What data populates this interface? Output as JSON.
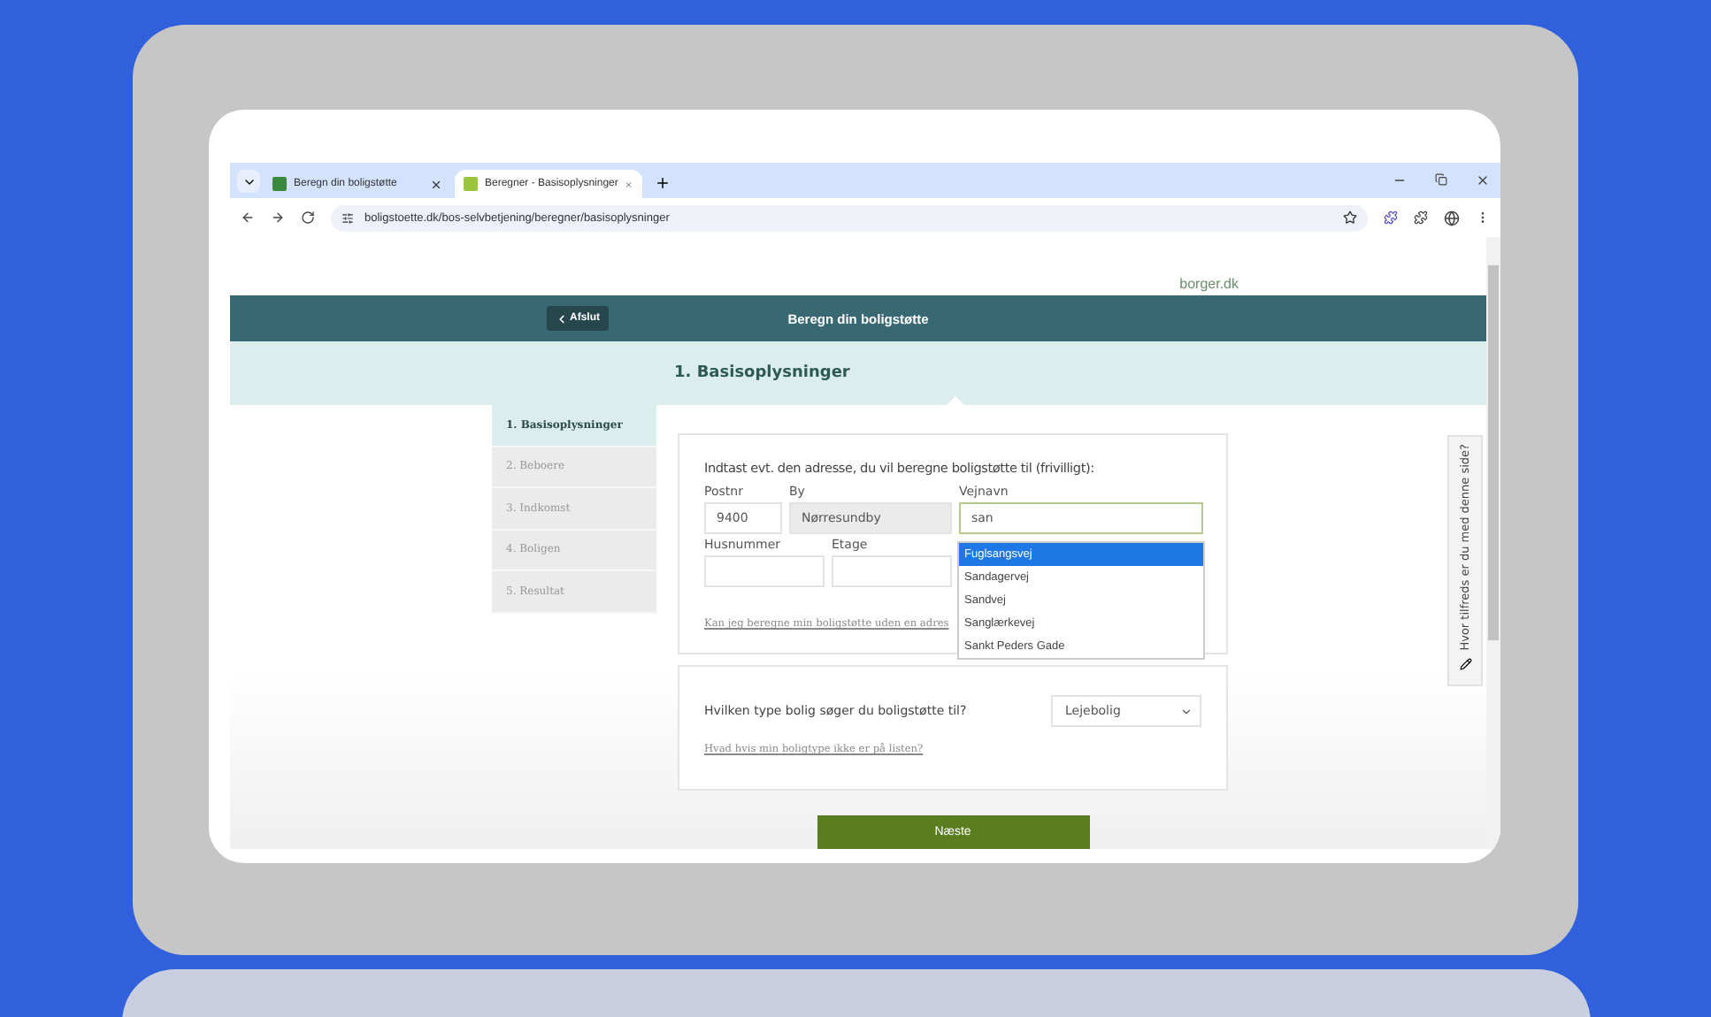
{
  "browser": {
    "tabs": [
      {
        "title": "Beregn din boligstøtte",
        "selected": false
      },
      {
        "title": "Beregner - Basisoplysninger",
        "selected": true
      }
    ],
    "url": "boligstoette.dk/bos-selvbetjening/beregner/basisoplysninger"
  },
  "brand": "borger.dk",
  "header": {
    "back_button": "Afslut",
    "title": "Beregn din boligstøtte"
  },
  "step_title": "1. Basisoplysninger",
  "steps": [
    {
      "label": "1. Basisoplysninger",
      "selected": true
    },
    {
      "label": "2. Beboere",
      "selected": false
    },
    {
      "label": "3. Indkomst",
      "selected": false
    },
    {
      "label": "4. Boligen",
      "selected": false
    },
    {
      "label": "5. Resultat",
      "selected": false
    }
  ],
  "address": {
    "prompt": "Indtast evt. den adresse, du vil beregne boligstøtte til (frivilligt):",
    "row_1": [
      {
        "label": "Postnr",
        "value": "9400",
        "disabled": false,
        "focused": false
      },
      {
        "label": "By",
        "value": "Nørresundby",
        "disabled": true,
        "focused": false
      },
      {
        "label": "Vejnavn",
        "value": "san",
        "disabled": false,
        "focused": true
      }
    ],
    "row_2": [
      {
        "label": "Husnummer",
        "disabled": false,
        "focused": false
      },
      {
        "label": "Etage",
        "disabled": false,
        "focused": false
      }
    ],
    "suggestions": [
      {
        "label": "Fuglsangsvej",
        "selected": true
      },
      {
        "label": "Sandagervej",
        "selected": false
      },
      {
        "label": "Sandvej",
        "selected": false
      },
      {
        "label": "Sanglærkevej",
        "selected": false
      },
      {
        "label": "Sankt Peders Gade",
        "selected": false
      }
    ],
    "link": "Kan jeg beregne min boligstøtte uden en adres"
  },
  "housing": {
    "question": "Hvilken type bolig søger du boligstøtte til?",
    "select_value": "Lejebolig",
    "link": "Hvad hvis min boligtype ikke er på listen?"
  },
  "next_button": "Næste",
  "feedback": "Hvor tilfreds er du med denne side?"
}
